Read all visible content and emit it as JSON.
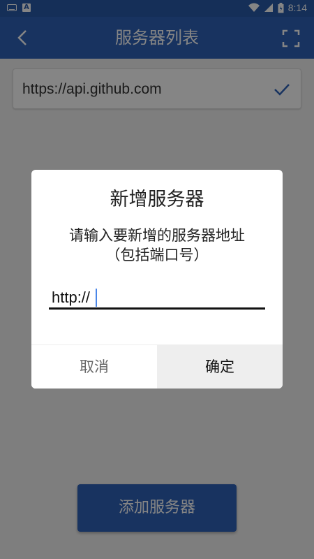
{
  "status_bar": {
    "time": "8:14"
  },
  "app_bar": {
    "title": "服务器列表"
  },
  "server_list": {
    "items": [
      {
        "url": "https://api.github.com"
      }
    ]
  },
  "add_button": {
    "label": "添加服务器"
  },
  "dialog": {
    "title": "新增服务器",
    "message_line1": "请输入要新增的服务器地址",
    "message_line2": "（包括端口号）",
    "input_value": "http://",
    "cancel_label": "取消",
    "ok_label": "确定"
  },
  "colors": {
    "primary": "#2f63b8",
    "status_bar": "#2a5aa9",
    "accent": "#4a86e8"
  },
  "icons": {
    "status_left": [
      "keyboard-icon",
      "a-notification-icon"
    ],
    "status_right": [
      "wifi-icon",
      "signal-icon",
      "battery-icon"
    ],
    "app_bar": [
      "back-arrow-icon",
      "fullscreen-icon"
    ],
    "server_item": "check-icon"
  }
}
